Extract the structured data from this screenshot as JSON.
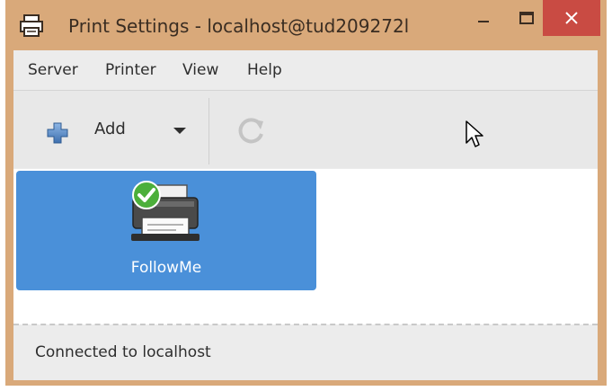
{
  "window": {
    "title": "Print Settings - localhost@tud209272l",
    "icon": "printer-app-icon",
    "controls": {
      "minimize": "minimize-icon",
      "maximize": "maximize-icon",
      "close": "close-icon"
    }
  },
  "menubar": {
    "items": [
      {
        "label": "Server"
      },
      {
        "label": "Printer"
      },
      {
        "label": "View"
      },
      {
        "label": "Help"
      }
    ]
  },
  "toolbar": {
    "add_label": "Add",
    "add_icon": "plus-icon",
    "refresh_icon": "refresh-icon"
  },
  "printers": [
    {
      "name": "FollowMe",
      "status": "default",
      "icon": "printer-icon",
      "selected": true
    }
  ],
  "statusbar": {
    "text": "Connected to localhost"
  },
  "colors": {
    "titlebar": "#d9a97a",
    "close_button": "#c94b43",
    "selection": "#4a90d9",
    "toolbar": "#e8e8e8"
  }
}
